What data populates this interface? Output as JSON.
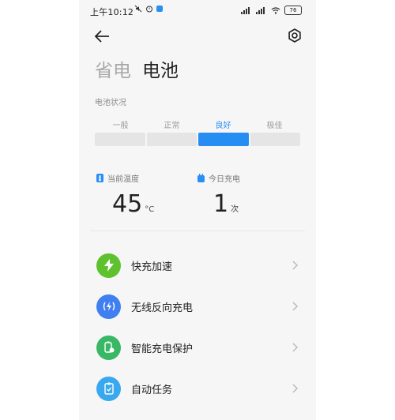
{
  "status_bar": {
    "time": "上午10:12",
    "battery": "76"
  },
  "header": {
    "tabs": [
      {
        "label": "省电",
        "active": false
      },
      {
        "label": "电池",
        "active": true
      }
    ]
  },
  "battery_status": {
    "title": "电池状况",
    "levels": [
      "一般",
      "正常",
      "良好",
      "极佳"
    ],
    "current_index": 2
  },
  "stats": {
    "temperature": {
      "label": "当前温度",
      "value": "45",
      "unit": "°C"
    },
    "charges_today": {
      "label": "今日充电",
      "value": "1",
      "unit": "次"
    }
  },
  "menu": [
    {
      "label": "快充加速",
      "icon": "lightning-icon",
      "color": "#5ec22f"
    },
    {
      "label": "无线反向充电",
      "icon": "wireless-charge-icon",
      "color": "#3f7ff0"
    },
    {
      "label": "智能充电保护",
      "icon": "battery-shield-icon",
      "color": "#38b865"
    },
    {
      "label": "自动任务",
      "icon": "clipboard-check-icon",
      "color": "#3aa8ef"
    }
  ],
  "colors": {
    "accent": "#268ef2",
    "background": "#f6f6f6"
  }
}
